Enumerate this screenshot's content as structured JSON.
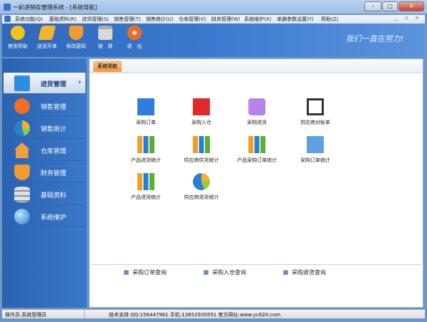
{
  "window": {
    "title": "一彩进销存管理系统 - [系统导航]",
    "min": "–",
    "max": "□",
    "close": "✕"
  },
  "menu": [
    "系统功能(Q)",
    "基础资料(R)",
    "进货管理(S)",
    "销售管理(T)",
    "销售统计(U)",
    "仓库管理(V)",
    "财务管理(W)",
    "系统维护(X)",
    "单据参数设置(Y)",
    "帮助(Z)"
  ],
  "menu_controls": [
    "_",
    "▫",
    "×"
  ],
  "toolbar": [
    {
      "label": "使用帮助",
      "icon": "lightbulb-icon",
      "color": "#f5c21a"
    },
    {
      "label": "送货开单",
      "icon": "package-icon",
      "color": "#f2b531"
    },
    {
      "label": "修改密码",
      "icon": "shield-icon",
      "color": "#ef9a2e"
    },
    {
      "label": "锁　屏",
      "icon": "lock-icon",
      "color": "#d8d8d8"
    },
    {
      "label": "退　出",
      "icon": "exit-icon",
      "color": "#f06a1c"
    }
  ],
  "slogan": "我们一直在努力!",
  "sidebar": [
    {
      "label": "进货管理",
      "icon": "blocks-icon",
      "color": "#2d8de0",
      "active": true,
      "arrow": "›"
    },
    {
      "label": "销售管理",
      "icon": "rss-icon",
      "color": "#f07020"
    },
    {
      "label": "销售统计",
      "icon": "pie-chart-icon",
      "color": "#3aa0e0"
    },
    {
      "label": "仓库管理",
      "icon": "house-icon",
      "color": "#f0a040"
    },
    {
      "label": "财务管理",
      "icon": "shield-icon",
      "color": "#f09a30"
    },
    {
      "label": "基础资料",
      "icon": "database-icon",
      "color": "#c0c6cc"
    },
    {
      "label": "系统维护",
      "icon": "globe-icon",
      "color": "#3a90e0"
    }
  ],
  "tab": "系统导航",
  "items": [
    {
      "label": "采购订单",
      "icon": "order-icon",
      "color": "#2f7de0"
    },
    {
      "label": "采购入仓",
      "icon": "basket-icon",
      "color": "#e02a2a"
    },
    {
      "label": "采购退货",
      "icon": "out-icon",
      "color": "#b684e8"
    },
    {
      "label": "供应商对账单",
      "icon": "calendar-icon",
      "color": "#333333"
    },
    {
      "label": "产品进货统计",
      "icon": "bar-chart-icon",
      "color": "#f0a020"
    },
    {
      "label": "供应商供货统计",
      "icon": "bar-chart-icon",
      "color": "#5ab030"
    },
    {
      "label": "产品采购订单统计",
      "icon": "bar-chart-icon",
      "color": "#5ab030"
    },
    {
      "label": "采购订单统计",
      "icon": "line-chart-icon",
      "color": "#60a0e0"
    },
    {
      "label": "产品退货统计",
      "icon": "bar-chart-icon",
      "color": "#5ab030"
    },
    {
      "label": "供应商退货统计",
      "icon": "pie-chart-icon",
      "color": "#2a80d0"
    }
  ],
  "links": [
    "采购订单查询",
    "采购入仓查询",
    "采购退货查询"
  ],
  "status": {
    "operator": "操作员:系统管理员",
    "support": "技术支持 QQ:156447981 手机:13652500551 官方网址:www.yc620.com"
  }
}
